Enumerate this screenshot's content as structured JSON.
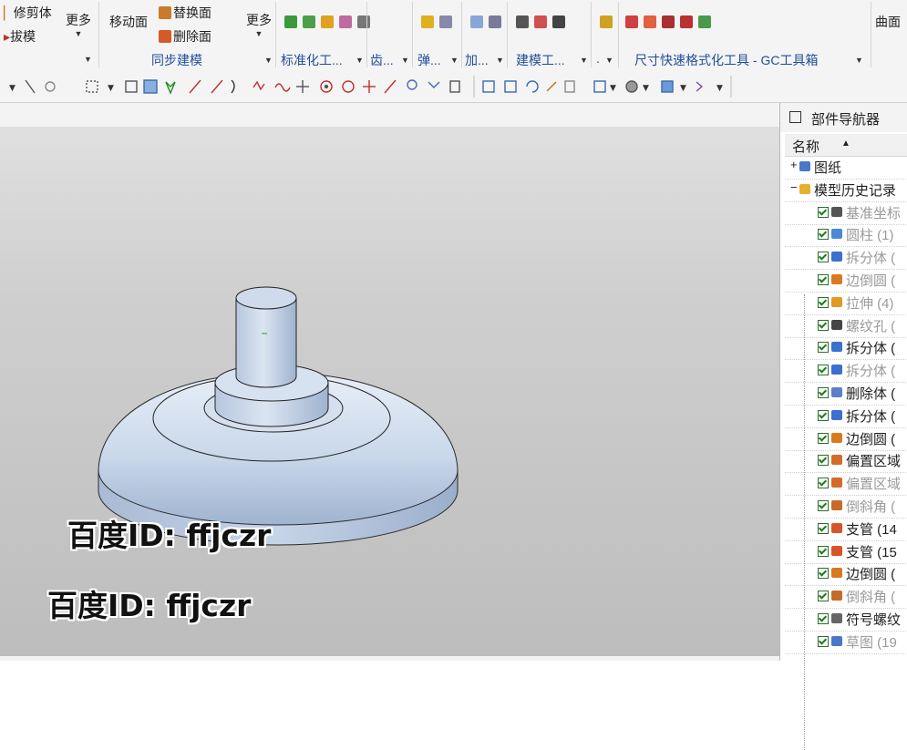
{
  "ribbon": {
    "left_items": [
      "修剪体",
      "拔模"
    ],
    "more1": "更多",
    "move_face": "移动面",
    "replace_face": "替换面",
    "delete_face": "删除面",
    "more2": "更多",
    "surface": "曲面"
  },
  "groups": [
    {
      "label": "同步建模"
    },
    {
      "label": "标准化工..."
    },
    {
      "label": "齿..."
    },
    {
      "label": "弹..."
    },
    {
      "label": "加..."
    },
    {
      "label": "建模工..."
    },
    {
      "label": "."
    },
    {
      "label": "尺寸快速格式化工具 - GC工具箱"
    }
  ],
  "watermark": [
    "百度ID: ffjczr",
    "百度ID: ffjczr"
  ],
  "navigator": {
    "title": "部件导航器",
    "column_name": "名称",
    "items": [
      {
        "label": "图纸",
        "type": "root",
        "dim": false,
        "icon_color": "#4a78c8"
      },
      {
        "label": "模型历史记录",
        "type": "folder",
        "dim": false,
        "icon_color": "#e8b030"
      },
      {
        "label": "基准坐标",
        "type": "feat",
        "dim": true,
        "icon_color": "#555555"
      },
      {
        "label": "圆柱 (1)",
        "type": "feat",
        "dim": true,
        "icon_color": "#4a88d8"
      },
      {
        "label": "拆分体 (",
        "type": "feat",
        "dim": true,
        "icon_color": "#3b6fd0"
      },
      {
        "label": "边倒圆 (",
        "type": "feat",
        "dim": true,
        "icon_color": "#d97a1f"
      },
      {
        "label": "拉伸 (4)",
        "type": "feat",
        "dim": true,
        "icon_color": "#e09a20"
      },
      {
        "label": "螺纹孔 (",
        "type": "feat",
        "dim": true,
        "icon_color": "#444444"
      },
      {
        "label": "拆分体 (",
        "type": "feat",
        "dim": false,
        "icon_color": "#3b6fd0"
      },
      {
        "label": "拆分体 (",
        "type": "feat",
        "dim": true,
        "icon_color": "#3b6fd0"
      },
      {
        "label": "删除体 (",
        "type": "feat",
        "dim": false,
        "icon_color": "#5b7fc8"
      },
      {
        "label": "拆分体 (",
        "type": "feat",
        "dim": false,
        "icon_color": "#3b6fd0"
      },
      {
        "label": "边倒圆 (",
        "type": "feat",
        "dim": false,
        "icon_color": "#d97a1f"
      },
      {
        "label": "偏置区域",
        "type": "feat",
        "dim": false,
        "icon_color": "#d56a2a"
      },
      {
        "label": "偏置区域",
        "type": "feat",
        "dim": true,
        "icon_color": "#d56a2a"
      },
      {
        "label": "倒斜角 (",
        "type": "feat",
        "dim": true,
        "icon_color": "#c86a2a"
      },
      {
        "label": "支管 (14",
        "type": "feat",
        "dim": false,
        "icon_color": "#d9532a"
      },
      {
        "label": "支管 (15",
        "type": "feat",
        "dim": false,
        "icon_color": "#d9532a"
      },
      {
        "label": "边倒圆 (",
        "type": "feat",
        "dim": false,
        "icon_color": "#d97a1f"
      },
      {
        "label": "倒斜角 (",
        "type": "feat",
        "dim": true,
        "icon_color": "#c86a2a"
      },
      {
        "label": "符号螺纹",
        "type": "feat",
        "dim": false,
        "icon_color": "#666666"
      },
      {
        "label": "草图 (19",
        "type": "feat",
        "dim": true,
        "icon_color": "#4a78c8"
      }
    ]
  },
  "colors": {
    "model_face": "#c9d8ea",
    "group_label": "#1f4e9a",
    "check": "#1f7a1f"
  }
}
